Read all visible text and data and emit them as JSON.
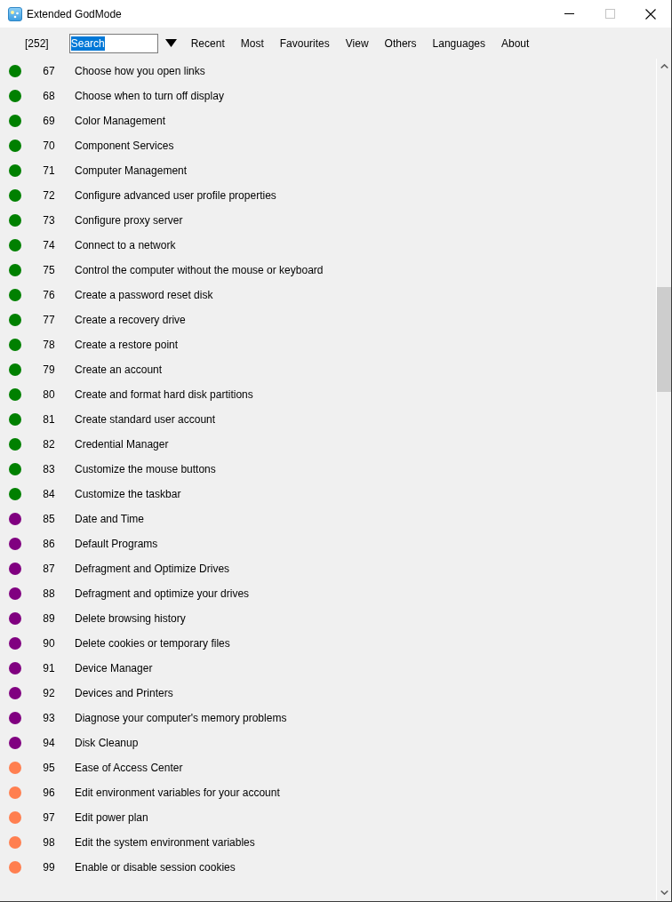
{
  "window": {
    "title": "Extended GodMode",
    "maximize_disabled": true
  },
  "toolbar": {
    "count": "[252]",
    "search": {
      "value": "Search",
      "selected": true
    },
    "menu": [
      "Recent",
      "Most",
      "Favourites",
      "View",
      "Others",
      "Languages",
      "About"
    ]
  },
  "items": [
    {
      "number": "67",
      "label": "Choose how you open links",
      "color": "#008000"
    },
    {
      "number": "68",
      "label": "Choose when to turn off display",
      "color": "#008000"
    },
    {
      "number": "69",
      "label": "Color Management",
      "color": "#008000"
    },
    {
      "number": "70",
      "label": "Component Services",
      "color": "#008000"
    },
    {
      "number": "71",
      "label": "Computer Management",
      "color": "#008000"
    },
    {
      "number": "72",
      "label": "Configure advanced user profile properties",
      "color": "#008000"
    },
    {
      "number": "73",
      "label": "Configure proxy server",
      "color": "#008000"
    },
    {
      "number": "74",
      "label": "Connect to a network",
      "color": "#008000"
    },
    {
      "number": "75",
      "label": "Control the computer without the mouse or keyboard",
      "color": "#008000"
    },
    {
      "number": "76",
      "label": "Create a password reset disk",
      "color": "#008000"
    },
    {
      "number": "77",
      "label": "Create a recovery drive",
      "color": "#008000"
    },
    {
      "number": "78",
      "label": "Create a restore point",
      "color": "#008000"
    },
    {
      "number": "79",
      "label": "Create an account",
      "color": "#008000"
    },
    {
      "number": "80",
      "label": "Create and format hard disk partitions",
      "color": "#008000"
    },
    {
      "number": "81",
      "label": "Create standard user account",
      "color": "#008000"
    },
    {
      "number": "82",
      "label": "Credential Manager",
      "color": "#008000"
    },
    {
      "number": "83",
      "label": "Customize the mouse buttons",
      "color": "#008000"
    },
    {
      "number": "84",
      "label": "Customize the taskbar",
      "color": "#008000"
    },
    {
      "number": "85",
      "label": "Date and Time",
      "color": "#800080"
    },
    {
      "number": "86",
      "label": "Default Programs",
      "color": "#800080"
    },
    {
      "number": "87",
      "label": "Defragment and Optimize Drives",
      "color": "#800080"
    },
    {
      "number": "88",
      "label": "Defragment and optimize your drives",
      "color": "#800080"
    },
    {
      "number": "89",
      "label": "Delete browsing history",
      "color": "#800080"
    },
    {
      "number": "90",
      "label": "Delete cookies or temporary files",
      "color": "#800080"
    },
    {
      "number": "91",
      "label": "Device Manager",
      "color": "#800080"
    },
    {
      "number": "92",
      "label": "Devices and Printers",
      "color": "#800080"
    },
    {
      "number": "93",
      "label": "Diagnose your computer's memory problems",
      "color": "#800080"
    },
    {
      "number": "94",
      "label": "Disk Cleanup",
      "color": "#800080"
    },
    {
      "number": "95",
      "label": "Ease of Access Center",
      "color": "#ff7f50"
    },
    {
      "number": "96",
      "label": "Edit environment variables for your account",
      "color": "#ff7f50"
    },
    {
      "number": "97",
      "label": "Edit power plan",
      "color": "#ff7f50"
    },
    {
      "number": "98",
      "label": "Edit the system environment variables",
      "color": "#ff7f50"
    },
    {
      "number": "99",
      "label": "Enable or disable session cookies",
      "color": "#ff7f50"
    }
  ]
}
